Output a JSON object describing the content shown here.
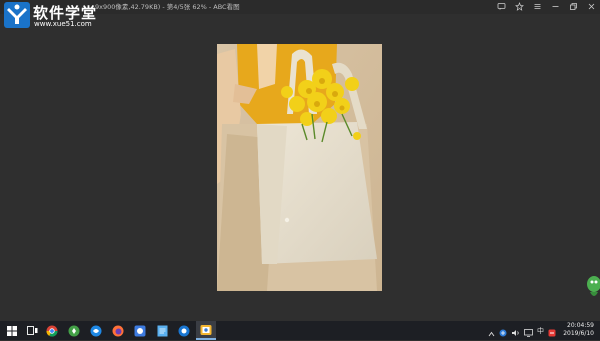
{
  "window": {
    "title": "9x900像素,42.79KB) - 第4/5张 62% - ABC看图",
    "buttons": [
      "message-icon",
      "skin-icon",
      "menu-icon",
      "minimize-icon",
      "restore-icon",
      "close-icon"
    ]
  },
  "watermark": {
    "name": "软件学堂",
    "url": "www.xue51.com"
  },
  "viewer": {
    "current_index": 4,
    "total": 5,
    "zoom_percent": 62
  },
  "taskbar": {
    "apps": [
      "start-icon",
      "task-view-icon",
      "chrome-icon",
      "app-green-icon",
      "app-blue-icon",
      "firefox-icon",
      "app-bluesquare-icon",
      "app-doc-icon",
      "app-globe-icon",
      "abc-viewer-icon"
    ],
    "tray": {
      "ime": "中",
      "time": "20:04:59",
      "date": "2019/6/10"
    }
  },
  "colors": {
    "background": "#2f2f2f",
    "taskbar": "#1d1f24",
    "accent": "#7fb0e0"
  }
}
